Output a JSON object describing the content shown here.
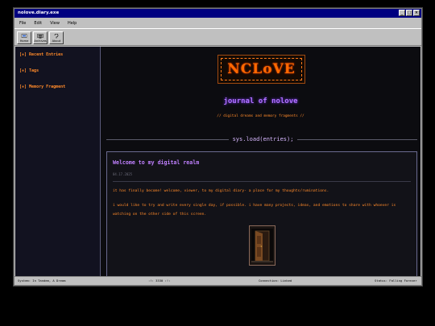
{
  "window": {
    "title": "nolove.diary.exe",
    "buttons": [
      "_",
      "□",
      "×"
    ]
  },
  "menu": [
    "File",
    "Edit",
    "View",
    "Help"
  ],
  "toolbar": [
    {
      "label": "Home",
      "icon": "home-icon"
    },
    {
      "label": "Archives",
      "icon": "archives-icon"
    },
    {
      "label": "About",
      "icon": "about-icon"
    }
  ],
  "sidebar": {
    "items": [
      "[+] Recent Entries",
      "[+] Tags",
      "[+] Memory Fragment"
    ]
  },
  "header": {
    "logo_text": "NCLoVE",
    "title": "journal of nolove",
    "subtitle": "// digital dreams and memory fragments //",
    "section_label": "sys.load(entries);"
  },
  "entry": {
    "title": "Welcome to my digital realm",
    "date": "04.17.2025",
    "paragraphs": [
      "it has finally become! welcome, viewer, to my digital diary- a place for my thoughts/ruminations.",
      "i would like to try and write every single day, if possible. i have many projects, ideas, and emotions to share with whoever is watching on the other side of this screen."
    ],
    "image_icon": "door-icon"
  },
  "status": {
    "left": "System: In Tandem, A Dream",
    "center": ":!: 3330 :!:",
    "connection": "Connection: Linked",
    "right": "Status: Falling Forever"
  },
  "colors": {
    "accent_orange": "#ff8a2a",
    "accent_purple": "#b070ff",
    "titlebar": "#000080",
    "background": "#0c0c10"
  }
}
